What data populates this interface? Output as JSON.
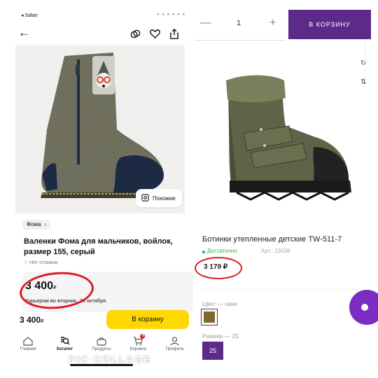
{
  "left_app": {
    "status_bar": {
      "back_app": "◂ Safari",
      "indicator": "● ● ● ● ● ●"
    },
    "top_icons": [
      "back-arrow",
      "compare-icon",
      "heart-icon",
      "share-icon"
    ],
    "similar_button": "Похожие",
    "brand_chip": "Фома",
    "product_title": "Валенки Фома для мальчиков, войлок, размер 155, серый",
    "reviews": "☆ Нет отзывов",
    "price": "3 400",
    "currency": "₽",
    "delivery": "Курьером во вторник, 24 октября",
    "bottom_price": "3 400",
    "cart_button": "В корзину",
    "tabs": [
      {
        "label": "Главная",
        "icon": "home-icon"
      },
      {
        "label": "Каталог",
        "icon": "search-icon"
      },
      {
        "label": "Продукты",
        "icon": "groceries-icon"
      },
      {
        "label": "Корзина",
        "icon": "cart-icon",
        "badge": "4"
      },
      {
        "label": "Профиль",
        "icon": "profile-icon"
      }
    ],
    "active_tab": "Каталог"
  },
  "right_app": {
    "qty_minus": "—",
    "quantity": "1",
    "qty_plus": "+",
    "cart_button": "В КОРЗИНУ",
    "product_title": "Ботинки утепленные детские TW-511-7",
    "stock": "Достаточно",
    "article": "Арт.: 13038",
    "price": "3 179 ₽",
    "color_label": "Цвет — хаки",
    "size_label": "Размер — 25",
    "size_value": "25",
    "accent": "#5d2a8a"
  },
  "watermark": "PIC·COLLAGE"
}
